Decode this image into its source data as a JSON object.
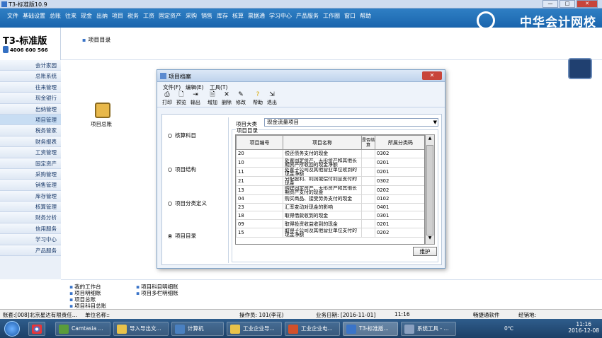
{
  "window": {
    "title": "T3-标准版10.9"
  },
  "menubar": {
    "items": [
      "文件",
      "基础设置",
      "总账",
      "往来",
      "现金",
      "出纳",
      "项目",
      "税务",
      "工资",
      "固定资产",
      "采购",
      "销售",
      "库存",
      "核算",
      "票据通",
      "学习中心",
      "产品服务",
      "工作圈",
      "窗口",
      "帮助"
    ],
    "brand": "中华会计网校"
  },
  "brand": {
    "name": "T3-标准版",
    "phone": "4006 600 566"
  },
  "breadcrumb": {
    "text": "项目目录"
  },
  "sidebar": {
    "items": [
      "会计家园",
      "总账系统",
      "往来管理",
      "现金银行",
      "出纳管理",
      "项目管理",
      "税务管家",
      "财务报表",
      "工资管理",
      "固定资产",
      "采购管理",
      "销售管理",
      "库存管理",
      "核算管理",
      "财务分析",
      "信用服务",
      "学习中心",
      "产品服务"
    ],
    "selected": "项目管理"
  },
  "desktop": {
    "icon_label": "项目总账"
  },
  "bottom_links": [
    "我的工作台",
    "项目明细账",
    "项目总账",
    "项目科目总账",
    "项目科目明细账",
    "项目多栏明细账"
  ],
  "statusbar": {
    "account": "账套:[008]北京星达有限责任...",
    "unit": "单位名称::",
    "operator": "操作员: 101(李花)",
    "bizdate": "业务日期: [2016-11-01]",
    "time": "11:16",
    "vendor": "畅捷通软件",
    "hotline": "经销地:"
  },
  "taskbar": {
    "items": [
      "Camtasia ...",
      "导入导出文...",
      "计算机",
      "工业企业导...",
      "工业企业电...",
      "T3-标准版...",
      "系统工具 - ..."
    ],
    "clock_time": "11:16",
    "clock_date": "2016-12-08",
    "weather": "0℃"
  },
  "dialog": {
    "title": "项目档案",
    "menu": [
      "文件(F)",
      "编辑(E)",
      "工具(T)"
    ],
    "toolbar": [
      "打印",
      "预览",
      "输出",
      "增加",
      "删除",
      "修改",
      "帮助",
      "退出"
    ],
    "radios": [
      "核算科目",
      "项目结构",
      "项目分类定义",
      "项目目录"
    ],
    "selected_radio": "项目目录",
    "category_label": "项目大类",
    "category_value": "现金流量项目",
    "list_label": "项目目录",
    "columns": [
      "项目编号",
      "项目名称",
      "是否结算",
      "所属分类码"
    ],
    "rows": [
      {
        "code": "20",
        "name": "偿还债务支付的现金",
        "settled": "",
        "class": "0302"
      },
      {
        "code": "10",
        "name": "处置固定资产、无形资产和其他长期资产所收回的现金净额",
        "settled": "",
        "class": "0201"
      },
      {
        "code": "11",
        "name": "处置子公司及其他营业单位收到的现金净额",
        "settled": "",
        "class": "0201"
      },
      {
        "code": "21",
        "name": "分配股利、利润或偿付利息支付的现金",
        "settled": "",
        "class": "0302"
      },
      {
        "code": "13",
        "name": "购建固定资产、无形资产和其他长期资产支付的现金",
        "settled": "",
        "class": "0202"
      },
      {
        "code": "04",
        "name": "购买商品、接受劳务支付的现金",
        "settled": "",
        "class": "0102"
      },
      {
        "code": "23",
        "name": "汇率变动对现金的影响",
        "settled": "",
        "class": "0401"
      },
      {
        "code": "18",
        "name": "取得借款收到的现金",
        "settled": "",
        "class": "0301"
      },
      {
        "code": "09",
        "name": "取得投资收益收到的现金",
        "settled": "",
        "class": "0201"
      },
      {
        "code": "15",
        "name": "取得子公司及其他营业单位支付的现金净额",
        "settled": "",
        "class": "0202"
      }
    ],
    "maintain_button": "维护"
  }
}
